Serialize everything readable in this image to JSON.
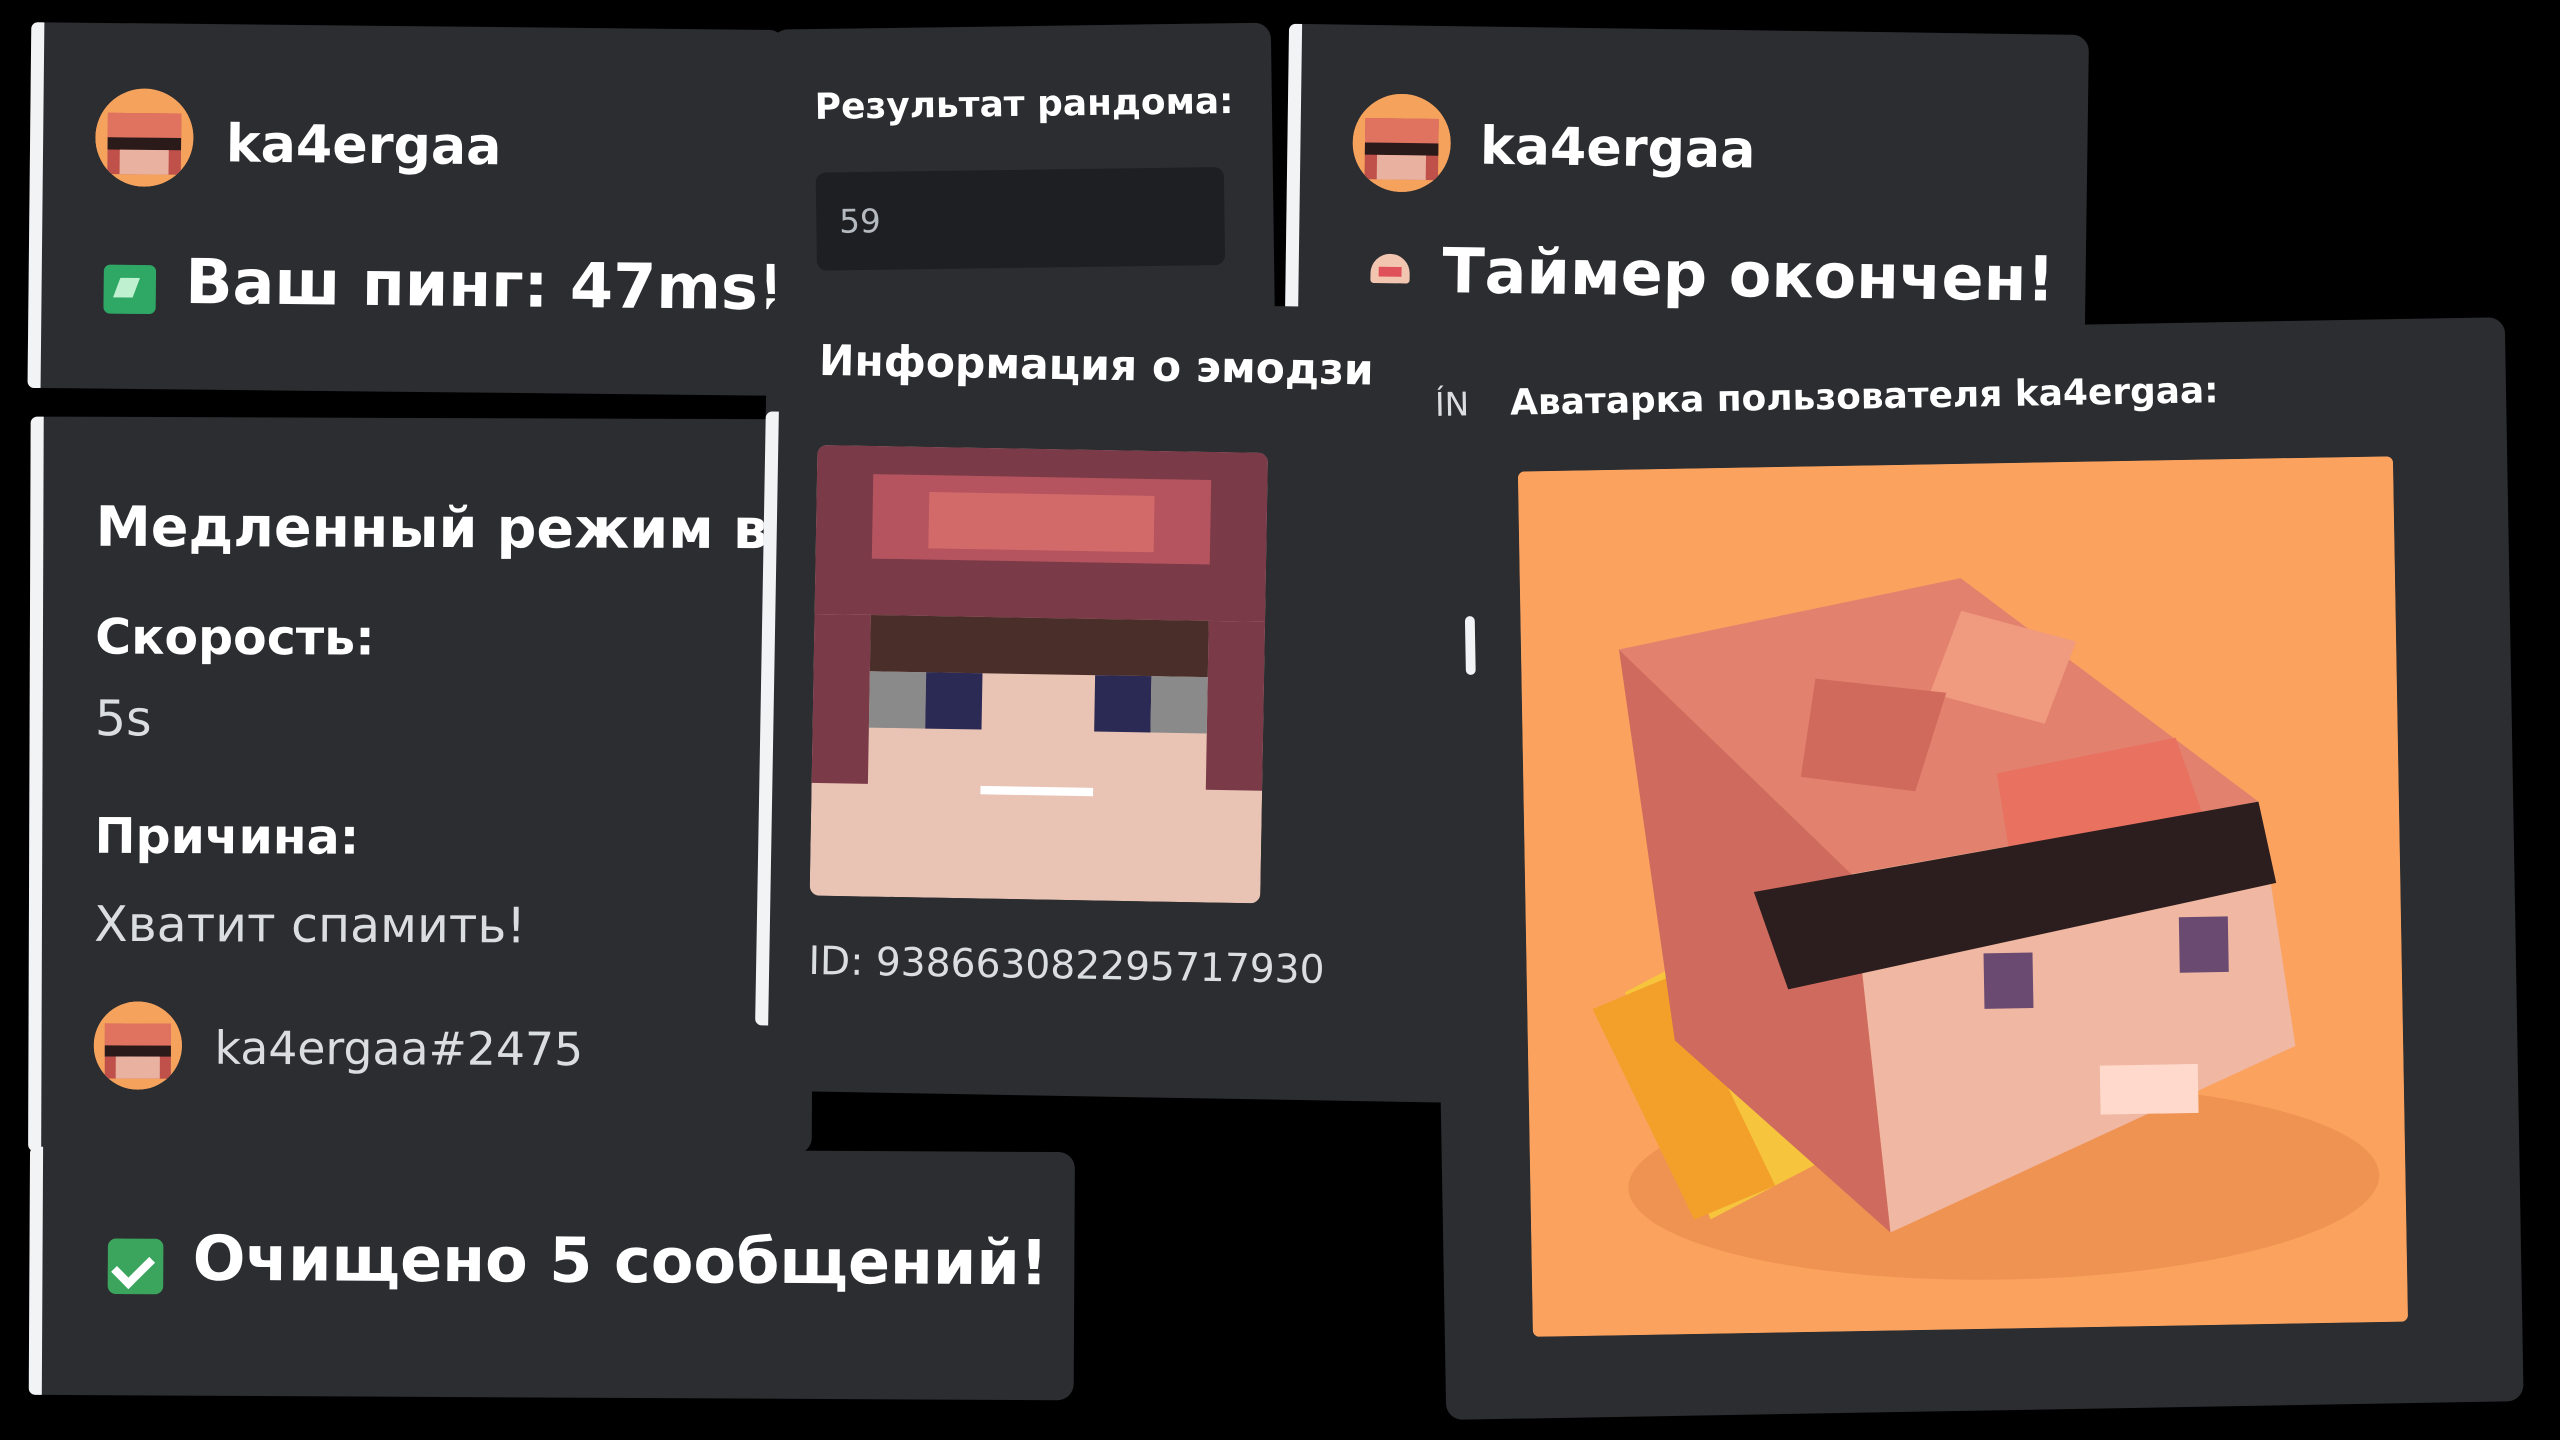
{
  "ping_card": {
    "author": "ka4ergaa",
    "message": "Ваш пинг: 47ms!"
  },
  "random_card": {
    "label": "Результат рандома:",
    "value": "59"
  },
  "timer_card": {
    "author": "ka4ergaa",
    "message": "Таймер окончен!"
  },
  "slowmode_card": {
    "title": "Медленный режим вк",
    "speed_label": "Скорость:",
    "speed_value": "5s",
    "reason_label": "Причина:",
    "reason_value": "Хватит спамить!",
    "moderator": "ka4ergaa#2475"
  },
  "emoji_card": {
    "title": "Информация о эмодзи",
    "id_text": "ID: 938663082295717930"
  },
  "avatar_card": {
    "title": "Аватарка пользователя ka4ergaa:",
    "peek_text": "ÍN"
  },
  "clear_card": {
    "message": "Очищено 5 сообщений!"
  },
  "colors": {
    "background": "#000000",
    "card": "#2b2d31",
    "input": "#1e1f22",
    "accent_bar": "#f2f3f5",
    "success_green": "#3ba55d",
    "avatar_orange": "#f5a25d"
  },
  "icons": [
    "avatar",
    "ping-signal-icon",
    "check-mark-icon",
    "timer-icon",
    "emoji-pixel-face",
    "avatar-3d-head"
  ]
}
